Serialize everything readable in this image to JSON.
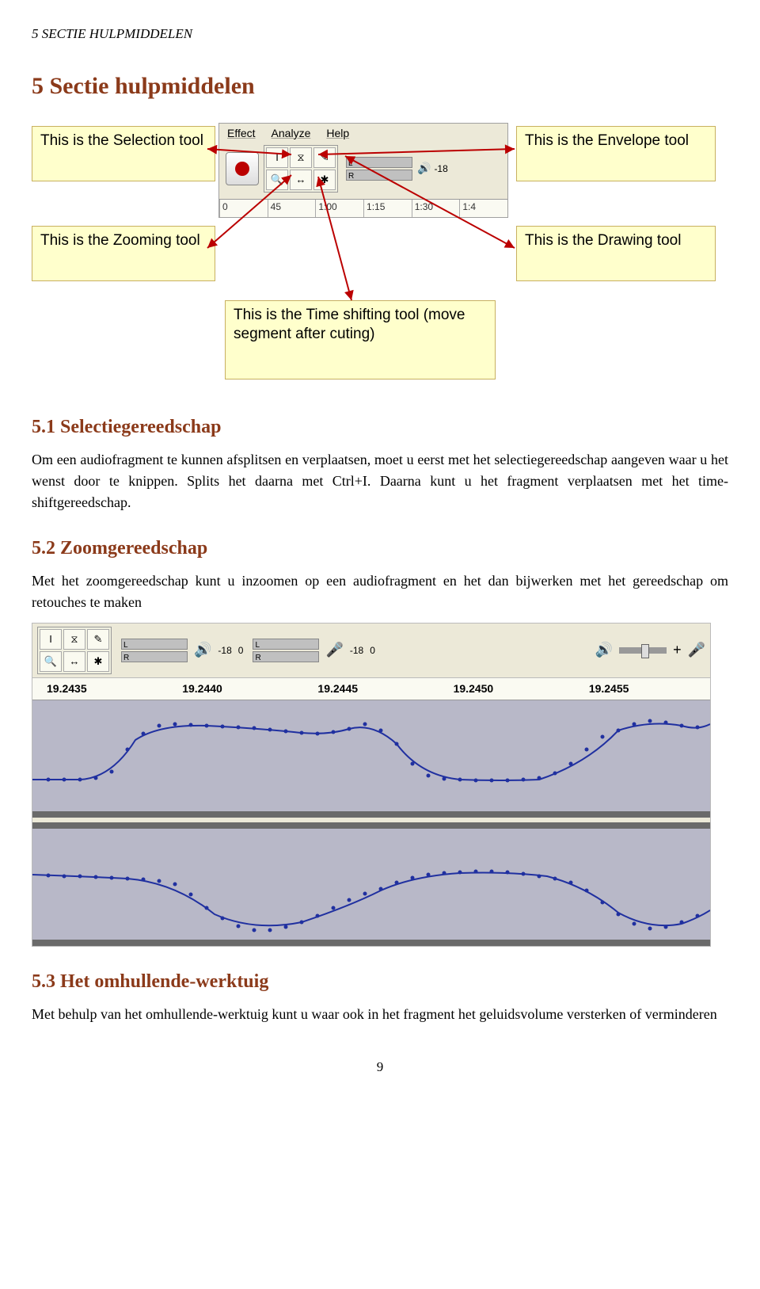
{
  "header": "5   SECTIE HULPMIDDELEN",
  "h1": "5   Sectie hulpmiddelen",
  "fig1": {
    "menu": {
      "effect": "Effect",
      "analyze": "Analyze",
      "help": "Help"
    },
    "callouts": {
      "selection": "This is the Selection tool",
      "zoom": "This is the Zooming tool",
      "envelope": "This is the Envelope tool",
      "draw": "This is the Drawing tool",
      "timeshift": "This is the Time shifting tool (move segment after cuting)"
    },
    "meters": {
      "l": "L",
      "r": "R",
      "neg18": "-18"
    },
    "ruler": [
      "0",
      "45",
      "1:00",
      "1:15",
      "1:30",
      "1:4"
    ],
    "tool_icons": {
      "ibeam": "I",
      "envelope": "⧖",
      "pencil": "✎",
      "zoom": "🔍",
      "timeshift": "↔",
      "multi": "✱"
    }
  },
  "sec51": {
    "title": "5.1   Selectiegereedschap",
    "p1": "Om een audiofragment te kunnen afsplitsen en verplaatsen, moet u eerst met het selectiegereedschap aangeven waar u het wenst door te knippen. Splits het daarna met Ctrl+I. Daarna kunt u het fragment verplaatsen met het time-shiftgereedschap."
  },
  "sec52": {
    "title": "5.2   Zoomgereedschap",
    "p1": "Met het zoomgereedschap kunt u inzoomen op een audiofragment en het dan bijwerken met het gereedschap om retouches te maken"
  },
  "fig2": {
    "meters": {
      "l": "L",
      "r": "R",
      "neg18a": "-18",
      "zero_a": "0",
      "neg18b": "-18",
      "zero_b": "0"
    },
    "ruler": [
      "19.2435",
      "19.2440",
      "19.2445",
      "19.2450",
      "19.2455"
    ],
    "tool_icons": {
      "ibeam": "I",
      "envelope": "⧖",
      "pencil": "✎",
      "zoom": "🔍",
      "timeshift": "↔",
      "multi": "✱",
      "speaker": "🔊",
      "mic": "🎤",
      "plus": "+"
    }
  },
  "sec53": {
    "title": "5.3   Het omhullende-werktuig",
    "p1": "Met behulp van het omhullende-werktuig kunt u waar ook in het fragment het geluidsvolume versterken of verminderen"
  },
  "page_number": "9"
}
